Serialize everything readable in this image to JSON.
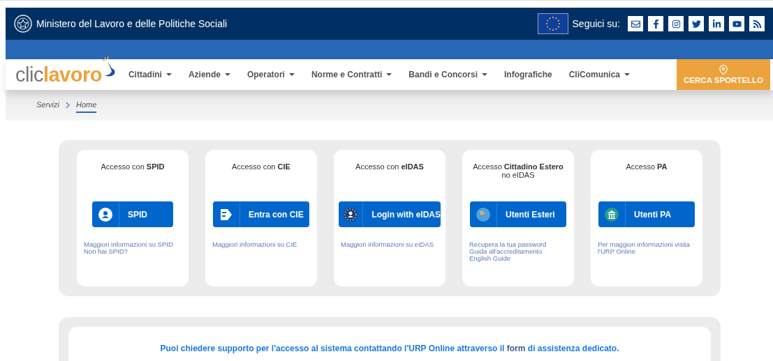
{
  "header": {
    "ministry": "Ministero del Lavoro e delle Politiche Sociali",
    "follow_label": "Seguici su:",
    "socials": [
      {
        "kind": "mail"
      },
      {
        "kind": "facebook"
      },
      {
        "kind": "instagram"
      },
      {
        "kind": "twitter"
      },
      {
        "kind": "linkedin"
      },
      {
        "kind": "youtube"
      },
      {
        "kind": "rss"
      }
    ]
  },
  "logo": {
    "parts": [
      "clic",
      "lavoro"
    ]
  },
  "nav": [
    {
      "label": "Cittadini",
      "dropdown": true
    },
    {
      "label": "Aziende",
      "dropdown": true
    },
    {
      "label": "Operatori",
      "dropdown": true
    },
    {
      "label": "Norme e Contratti",
      "dropdown": true
    },
    {
      "label": "Bandi e Concorsi",
      "dropdown": true
    },
    {
      "label": "Infografiche",
      "dropdown": false
    },
    {
      "label": "CliComunica",
      "dropdown": true
    }
  ],
  "cta": "CERCA SPORTELLO",
  "breadcrumb": [
    {
      "label": "Servizi",
      "selected": false
    },
    {
      "label": "Home",
      "selected": true
    }
  ],
  "access_cards": [
    {
      "heading": "Accesso con **SPID**",
      "kind": "spid",
      "button": "SPID",
      "links": [
        "Maggiori informazioni su SPID",
        "Non hai SPID?"
      ]
    },
    {
      "heading": "Accesso con **CIE**",
      "kind": "cie",
      "button": "Entra con CIE",
      "links": [
        "Maggiori informazioni su CIE"
      ]
    },
    {
      "heading": "Accesso con **eIDAS**",
      "kind": "eidas",
      "button": "Login with eIDAS",
      "links": [
        "Maggiori informazioni su eIDAS"
      ]
    },
    {
      "heading": "Accesso **Cittadino Estero**",
      "subheading": "no eIDAS",
      "kind": "globe",
      "button": "Utenti Esteri",
      "links": [
        "Recupera la tua password",
        "Guida all'accreditamento",
        "English Guide"
      ]
    },
    {
      "heading": "Accesso **PA**",
      "kind": "pa",
      "button": "Utenti PA",
      "links": [
        "Per maggiori informazioni visita",
        "l'URP Online"
      ]
    }
  ],
  "support": {
    "before": "Puoi chiedere supporto per l'accesso al sistema contattando l'URP Online attraverso il",
    "link": "form",
    "after": "di assistenza dedicato."
  }
}
